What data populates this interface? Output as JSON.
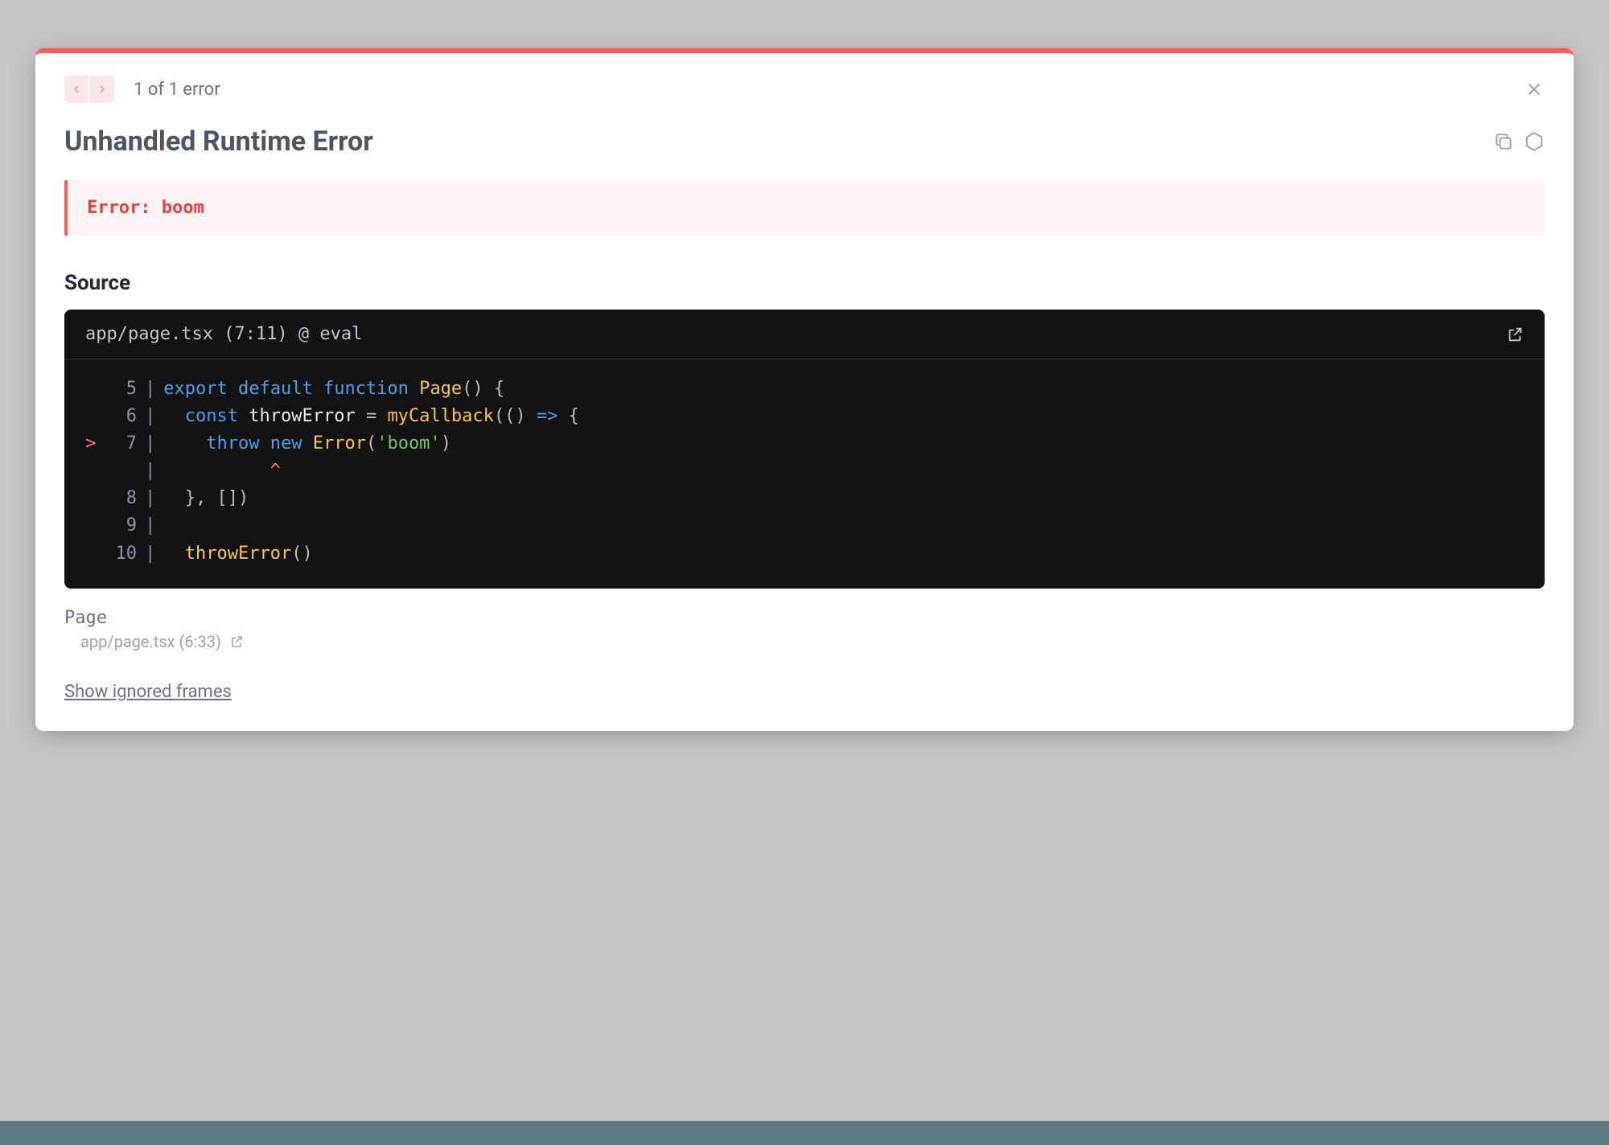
{
  "nav": {
    "counter": "1 of 1 error"
  },
  "title": "Unhandled Runtime Error",
  "error_message": "Error: boom",
  "section_heading": "Source",
  "code": {
    "header": "app/page.tsx (7:11) @ eval",
    "lines": [
      {
        "num": "5",
        "mark": " ",
        "segments": [
          {
            "t": "export",
            "c": "tok-kw"
          },
          {
            "t": " ",
            "c": ""
          },
          {
            "t": "default",
            "c": "tok-kw"
          },
          {
            "t": " ",
            "c": ""
          },
          {
            "t": "function",
            "c": "tok-kw"
          },
          {
            "t": " ",
            "c": ""
          },
          {
            "t": "Page",
            "c": "tok-fn"
          },
          {
            "t": "() {",
            "c": "tok-op"
          }
        ]
      },
      {
        "num": "6",
        "mark": " ",
        "segments": [
          {
            "t": "  ",
            "c": ""
          },
          {
            "t": "const",
            "c": "tok-kw"
          },
          {
            "t": " throwError ",
            "c": "tok-id"
          },
          {
            "t": "=",
            "c": "tok-op"
          },
          {
            "t": " ",
            "c": ""
          },
          {
            "t": "myCallback",
            "c": "tok-fn"
          },
          {
            "t": "(() ",
            "c": "tok-op"
          },
          {
            "t": "=>",
            "c": "tok-kw"
          },
          {
            "t": " {",
            "c": "tok-op"
          }
        ]
      },
      {
        "num": "7",
        "mark": ">",
        "segments": [
          {
            "t": "    ",
            "c": ""
          },
          {
            "t": "throw",
            "c": "tok-kw"
          },
          {
            "t": " ",
            "c": ""
          },
          {
            "t": "new",
            "c": "tok-kw"
          },
          {
            "t": " ",
            "c": ""
          },
          {
            "t": "Error",
            "c": "tok-fn"
          },
          {
            "t": "(",
            "c": "tok-op"
          },
          {
            "t": "'boom'",
            "c": "tok-str"
          },
          {
            "t": ")",
            "c": "tok-op"
          }
        ]
      },
      {
        "num": "",
        "mark": " ",
        "segments": [
          {
            "t": "          ^",
            "c": "caret-line"
          }
        ]
      },
      {
        "num": "8",
        "mark": " ",
        "segments": [
          {
            "t": "  }, [])",
            "c": "tok-op"
          }
        ]
      },
      {
        "num": "9",
        "mark": " ",
        "segments": [
          {
            "t": "",
            "c": ""
          }
        ]
      },
      {
        "num": "10",
        "mark": " ",
        "segments": [
          {
            "t": "  ",
            "c": ""
          },
          {
            "t": "throwError",
            "c": "tok-fn"
          },
          {
            "t": "()",
            "c": "tok-op"
          }
        ]
      }
    ]
  },
  "frame": {
    "name": "Page",
    "location": "app/page.tsx (6:33)"
  },
  "show_ignored_label": "Show ignored frames"
}
